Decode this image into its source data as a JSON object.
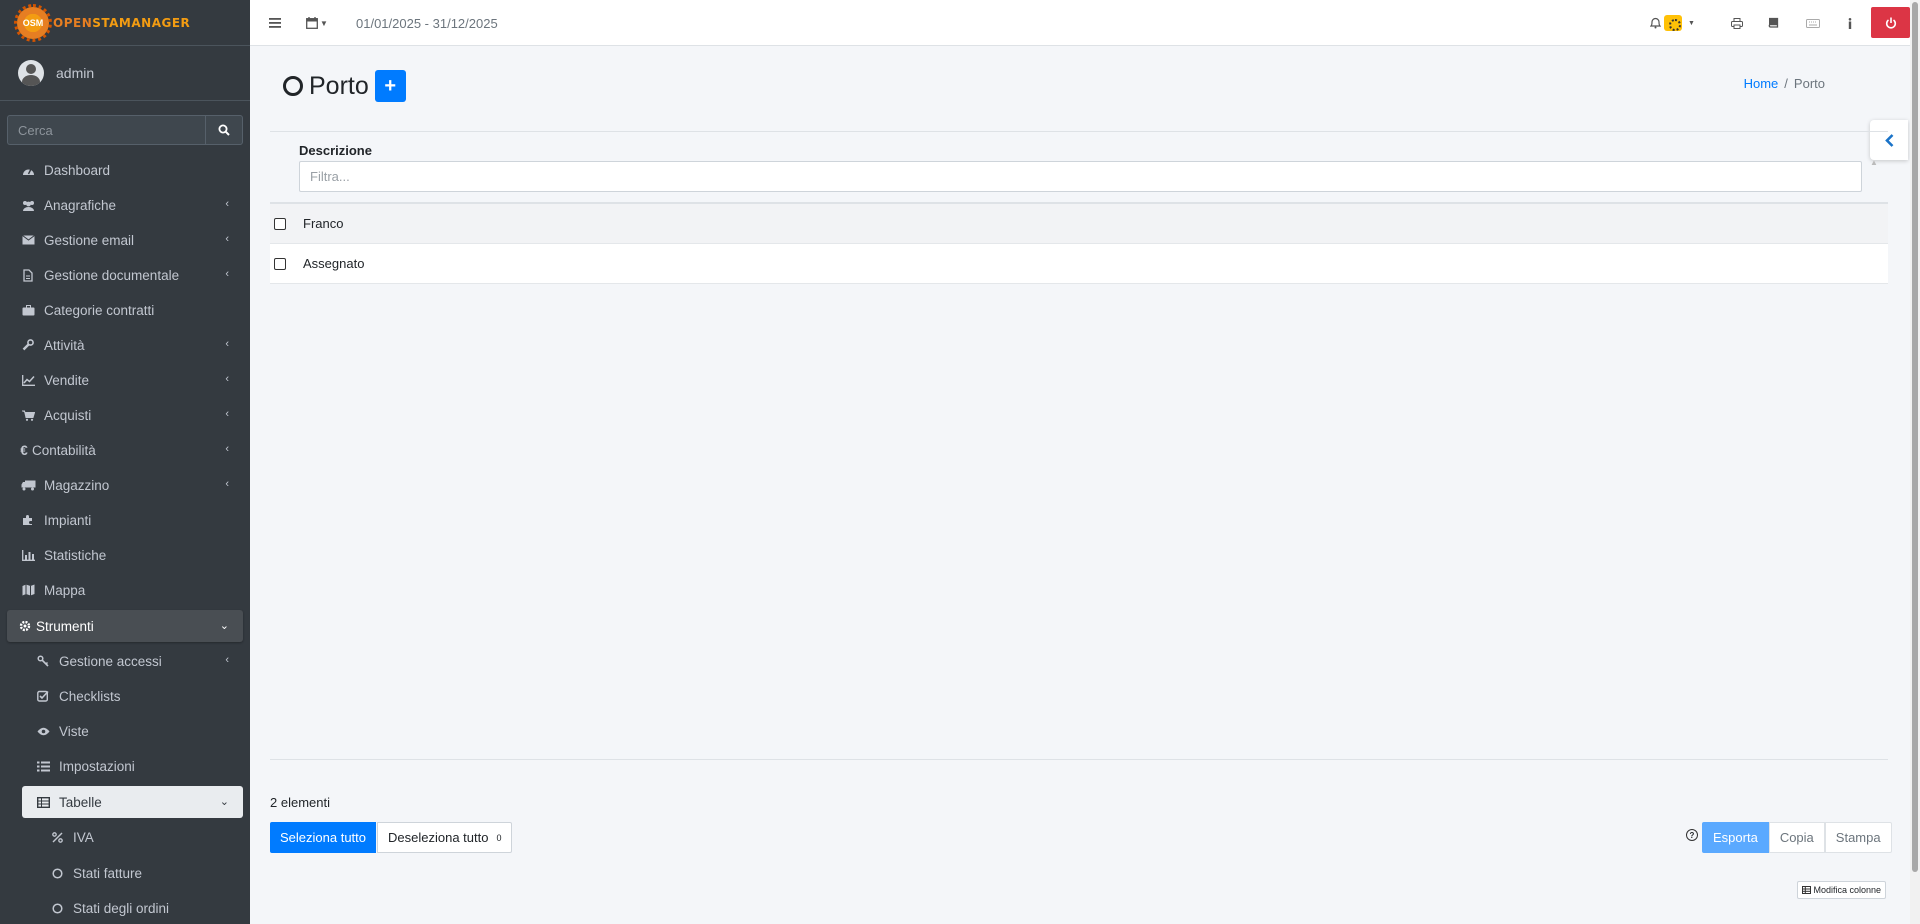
{
  "brand": {
    "logo_text": "OSM",
    "name_part1": "OPEN",
    "name_part2": "STAMANAGER"
  },
  "user": {
    "name": "admin"
  },
  "sidebar": {
    "search_placeholder": "Cerca",
    "items": [
      {
        "label": "Dashboard",
        "icon": "dashboard-icon"
      },
      {
        "label": "Anagrafiche",
        "icon": "users-icon"
      },
      {
        "label": "Gestione email",
        "icon": "envelope-icon"
      },
      {
        "label": "Gestione documentale",
        "icon": "file-icon"
      },
      {
        "label": "Categorie contratti",
        "icon": "briefcase-icon"
      },
      {
        "label": "Attività",
        "icon": "wrench-icon"
      },
      {
        "label": "Vendite",
        "icon": "line-chart-icon"
      },
      {
        "label": "Acquisti",
        "icon": "cart-icon"
      },
      {
        "label": "Contabilità",
        "icon": "euro-icon"
      },
      {
        "label": "Magazzino",
        "icon": "truck-icon"
      },
      {
        "label": "Impianti",
        "icon": "puzzle-icon"
      },
      {
        "label": "Statistiche",
        "icon": "bar-chart-icon"
      },
      {
        "label": "Mappa",
        "icon": "map-icon"
      },
      {
        "label": "Strumenti",
        "icon": "cog-icon"
      }
    ],
    "strumenti_sub": [
      {
        "label": "Gestione accessi",
        "icon": "key-icon"
      },
      {
        "label": "Checklists",
        "icon": "check-square-icon"
      },
      {
        "label": "Viste",
        "icon": "eye-icon"
      },
      {
        "label": "Impostazioni",
        "icon": "list-icon"
      },
      {
        "label": "Tabelle",
        "icon": "table-icon"
      }
    ],
    "tabelle_sub": [
      {
        "label": "IVA",
        "icon": "percent-icon"
      },
      {
        "label": "Stati fatture",
        "icon": "circle-icon"
      },
      {
        "label": "Stati degli ordini",
        "icon": "circle-icon"
      }
    ]
  },
  "topbar": {
    "date_range": "01/01/2025 - 31/12/2025"
  },
  "page": {
    "title": "Porto",
    "add_label": "+"
  },
  "breadcrumb": {
    "home": "Home",
    "separator": "/",
    "current": "Porto"
  },
  "table": {
    "column": "Descrizione",
    "filter_placeholder": "Filtra...",
    "rows": [
      "Franco",
      "Assegnato"
    ]
  },
  "footer": {
    "count_text": "2 elementi",
    "select_all": "Seleziona tutto",
    "deselect_all": "Deseleziona tutto",
    "selected_count": "0",
    "export": "Esporta",
    "copy": "Copia",
    "print": "Stampa",
    "modify_columns": "Modifica colonne"
  },
  "colors": {
    "accent": "#007bff",
    "sidebar_bg": "#343a40",
    "danger": "#dc3545",
    "warning": "#ffc107"
  }
}
